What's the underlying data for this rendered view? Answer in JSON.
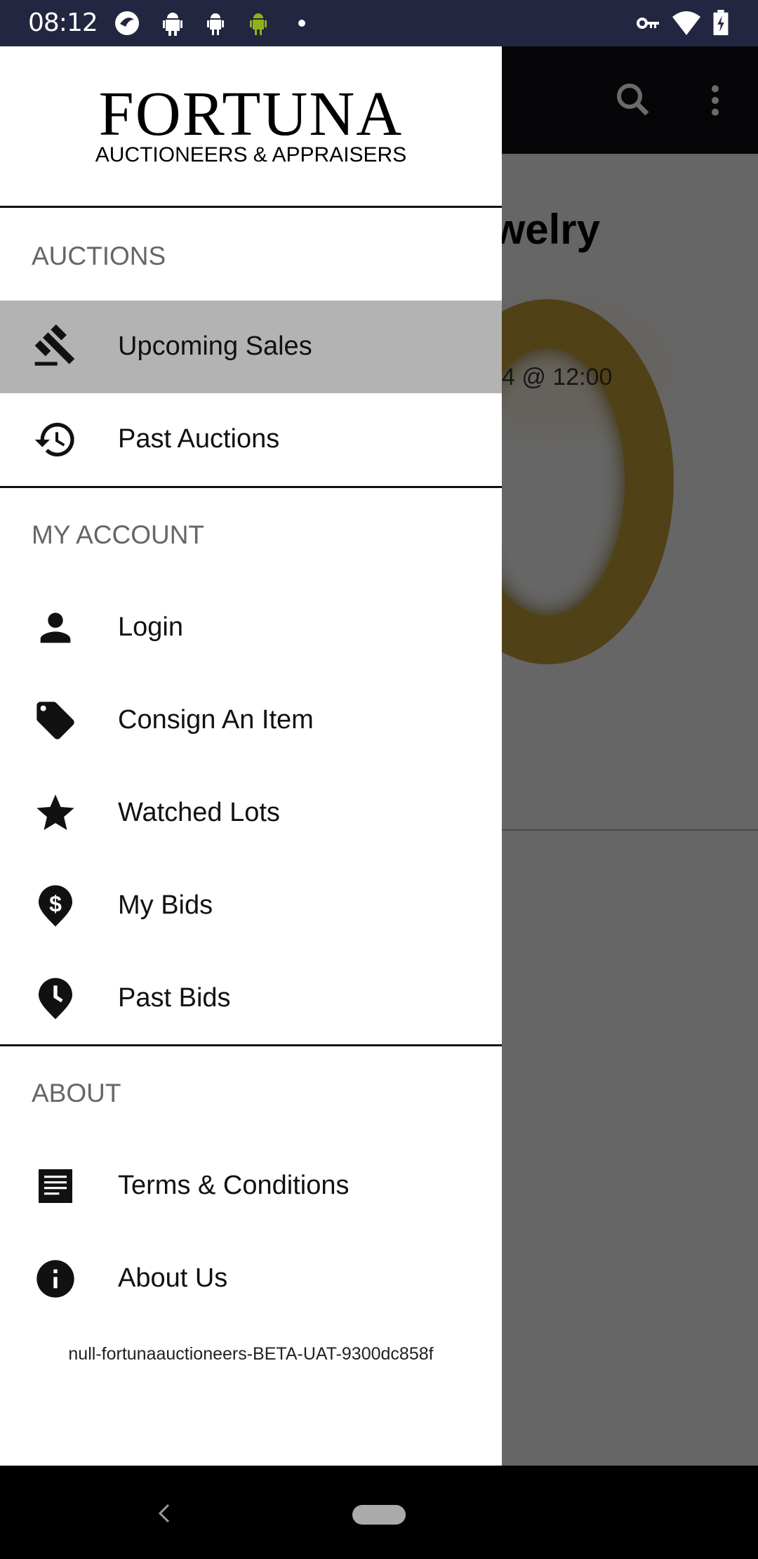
{
  "status_bar": {
    "time": "08:12",
    "icons": [
      "app-icon",
      "android-icon",
      "android-icon",
      "android-green-icon",
      "dot-icon",
      "vpn-key-icon",
      "wifi-icon",
      "battery-charging-icon"
    ]
  },
  "background": {
    "title": "welry",
    "date": "4 @ 12:00",
    "toolbar_icons": [
      "search-icon",
      "more-vert-icon"
    ]
  },
  "drawer": {
    "logo": {
      "name": "FORTUNA",
      "tagline": "AUCTIONEERS & APPRAISERS"
    },
    "sections": [
      {
        "header": "AUCTIONS",
        "items": [
          {
            "label": "Upcoming Sales",
            "icon": "gavel-icon",
            "active": true
          },
          {
            "label": "Past Auctions",
            "icon": "history-icon"
          }
        ]
      },
      {
        "header": "MY ACCOUNT",
        "items": [
          {
            "label": "Login",
            "icon": "person-icon"
          },
          {
            "label": "Consign An Item",
            "icon": "tag-icon"
          },
          {
            "label": "Watched Lots",
            "icon": "star-icon"
          },
          {
            "label": "My Bids",
            "icon": "dollar-pin-icon"
          },
          {
            "label": "Past Bids",
            "icon": "clock-pin-icon"
          }
        ]
      },
      {
        "header": "ABOUT",
        "items": [
          {
            "label": "Terms & Conditions",
            "icon": "document-icon"
          },
          {
            "label": "About Us",
            "icon": "info-icon"
          }
        ]
      }
    ],
    "version": "null-fortunaauctioneers-BETA-UAT-9300dc858f"
  },
  "colors": {
    "status_bar": "#222640",
    "active_item": "#b3b3b3",
    "toolbar": "#0f1018"
  }
}
